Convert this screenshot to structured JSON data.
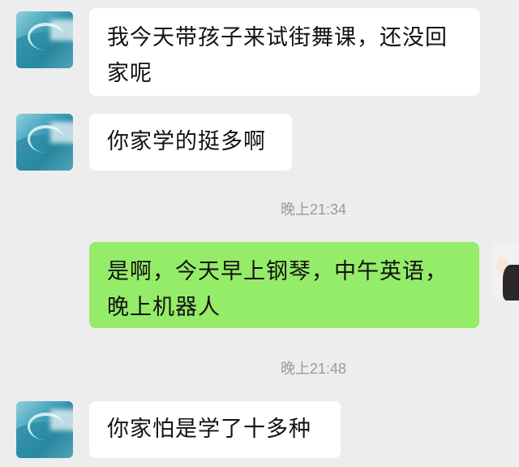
{
  "messages": [
    {
      "sender": "other",
      "lines": [
        "我今天带孩子来试街舞课，还没回",
        "家呢"
      ]
    },
    {
      "sender": "other",
      "text": "你家学的挺多啊"
    },
    {
      "time": "晚上21:34"
    },
    {
      "sender": "self",
      "lines": [
        "是啊，今天早上钢琴，中午英语，",
        "晚上机器人"
      ]
    },
    {
      "time": "晚上21:48"
    },
    {
      "sender": "other",
      "text": "你家怕是学了十多种"
    }
  ],
  "colors": {
    "background": "#ededed",
    "incoming_bubble": "#ffffff",
    "outgoing_bubble": "#95ec69",
    "timestamp": "#9a9a9a"
  },
  "avatars": {
    "other": "ocean-wave-avatar",
    "self": "person-avatar"
  }
}
